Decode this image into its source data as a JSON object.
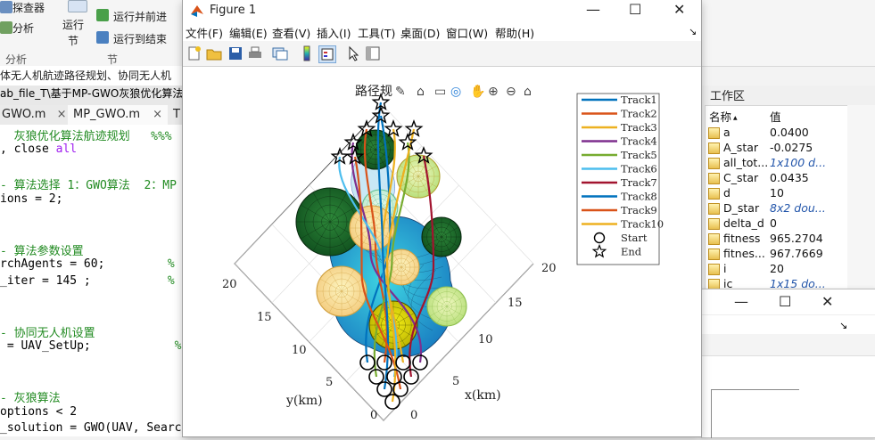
{
  "ribbon": {
    "btn_find": "探查器",
    "btn_analyze": "分析",
    "group_analyze": "分析",
    "btn_run_section": "运行",
    "btn_run_section2": "节",
    "btn_run_advance": "运行并前进",
    "btn_run_to_end": "运行到结束",
    "group_section": "节"
  },
  "path_bar": "体无人机航迹路径规划、协同无人机",
  "title_strip": "ab_file_T\\基于MP-GWO灰狼优化算法",
  "editor_tabs": [
    {
      "label": "GWO.m",
      "close": "×"
    },
    {
      "label": "MP_GWO.m",
      "close": "×"
    },
    {
      "label": "T"
    }
  ],
  "code_lines": [
    {
      "parts": [
        {
          "t": "  灰狼优化算法航迹规划   %%%",
          "c": "cm"
        }
      ]
    },
    {
      "parts": [
        {
          "t": ", close ",
          "c": ""
        },
        {
          "t": "all",
          "c": "pc"
        }
      ]
    },
    {
      "parts": []
    },
    {
      "parts": [
        {
          "t": "- 算法选择 1：GWO算法  2：MP",
          "c": "cm"
        }
      ]
    },
    {
      "parts": [
        {
          "t": "ions = 2;",
          "c": ""
        }
      ]
    },
    {
      "parts": []
    },
    {
      "parts": []
    },
    {
      "parts": [
        {
          "t": "- 算法参数设置",
          "c": "cm"
        }
      ]
    },
    {
      "parts": [
        {
          "t": "rchAgents = 60;",
          "c": ""
        },
        {
          "t": "         %",
          "c": "cm"
        }
      ]
    },
    {
      "parts": [
        {
          "t": "_iter = 145 ;",
          "c": ""
        },
        {
          "t": "           %",
          "c": "cm"
        }
      ]
    },
    {
      "parts": []
    },
    {
      "parts": []
    },
    {
      "parts": [
        {
          "t": "- 协同无人机设置",
          "c": "cm"
        }
      ]
    },
    {
      "parts": [
        {
          "t": " = UAV_SetUp;",
          "c": ""
        },
        {
          "t": "            %",
          "c": "cm"
        }
      ]
    },
    {
      "parts": []
    },
    {
      "parts": []
    },
    {
      "parts": [
        {
          "t": "- 灰狼算法",
          "c": "cm"
        }
      ]
    },
    {
      "parts": [
        {
          "t": "options < 2",
          "c": ""
        }
      ]
    },
    {
      "parts": [
        {
          "t": "_solution = GWO(UAV, Search",
          "c": ""
        }
      ]
    }
  ],
  "workspace": {
    "title": "工作区",
    "col_name": "名称",
    "sort_arrow": "▲",
    "col_value": "值",
    "rows": [
      {
        "name": "a",
        "value": "0.0400",
        "italic": false
      },
      {
        "name": "A_star",
        "value": "-0.0275",
        "italic": false
      },
      {
        "name": "all_tot...",
        "value": "1x100 d...",
        "italic": true
      },
      {
        "name": "C_star",
        "value": "0.0435",
        "italic": false
      },
      {
        "name": "d",
        "value": "10",
        "italic": false
      },
      {
        "name": "D_star",
        "value": "8x2 dou...",
        "italic": true
      },
      {
        "name": "delta_d",
        "value": "0",
        "italic": false
      },
      {
        "name": "fitness",
        "value": "965.2704",
        "italic": false
      },
      {
        "name": "fitnes...",
        "value": "967.7669",
        "italic": false
      },
      {
        "name": "i",
        "value": "20",
        "italic": false
      },
      {
        "name": "ic",
        "value": "1x15 do...",
        "italic": true
      }
    ]
  },
  "figure": {
    "title": "Figure 1",
    "menu": [
      "文件(F)",
      "编辑(E)",
      "查看(V)",
      "插入(I)",
      "工具(T)",
      "桌面(D)",
      "窗口(W)",
      "帮助(H)"
    ],
    "menu_arrow": "↘",
    "plot_title": "路径规",
    "legend": [
      {
        "label": "Track1",
        "color": "#0072bd"
      },
      {
        "label": "Track2",
        "color": "#d95319"
      },
      {
        "label": "Track3",
        "color": "#edb120"
      },
      {
        "label": "Track4",
        "color": "#7e2f8e"
      },
      {
        "label": "Track5",
        "color": "#77ac30"
      },
      {
        "label": "Track6",
        "color": "#4dbeee"
      },
      {
        "label": "Track7",
        "color": "#a2142f"
      },
      {
        "label": "Track8",
        "color": "#0072bd"
      },
      {
        "label": "Track9",
        "color": "#d95319"
      },
      {
        "label": "Track10",
        "color": "#edb120"
      },
      {
        "label": "Start",
        "marker": "circle"
      },
      {
        "label": "End",
        "marker": "star"
      }
    ],
    "ylabel": "y(km)",
    "xlabel": "x(km)",
    "y_ticks": [
      "20",
      "15",
      "10",
      "5",
      "0"
    ],
    "x_ticks": [
      "0",
      "5",
      "10",
      "15",
      "20"
    ]
  },
  "fig2": {
    "arrow": "↘"
  }
}
